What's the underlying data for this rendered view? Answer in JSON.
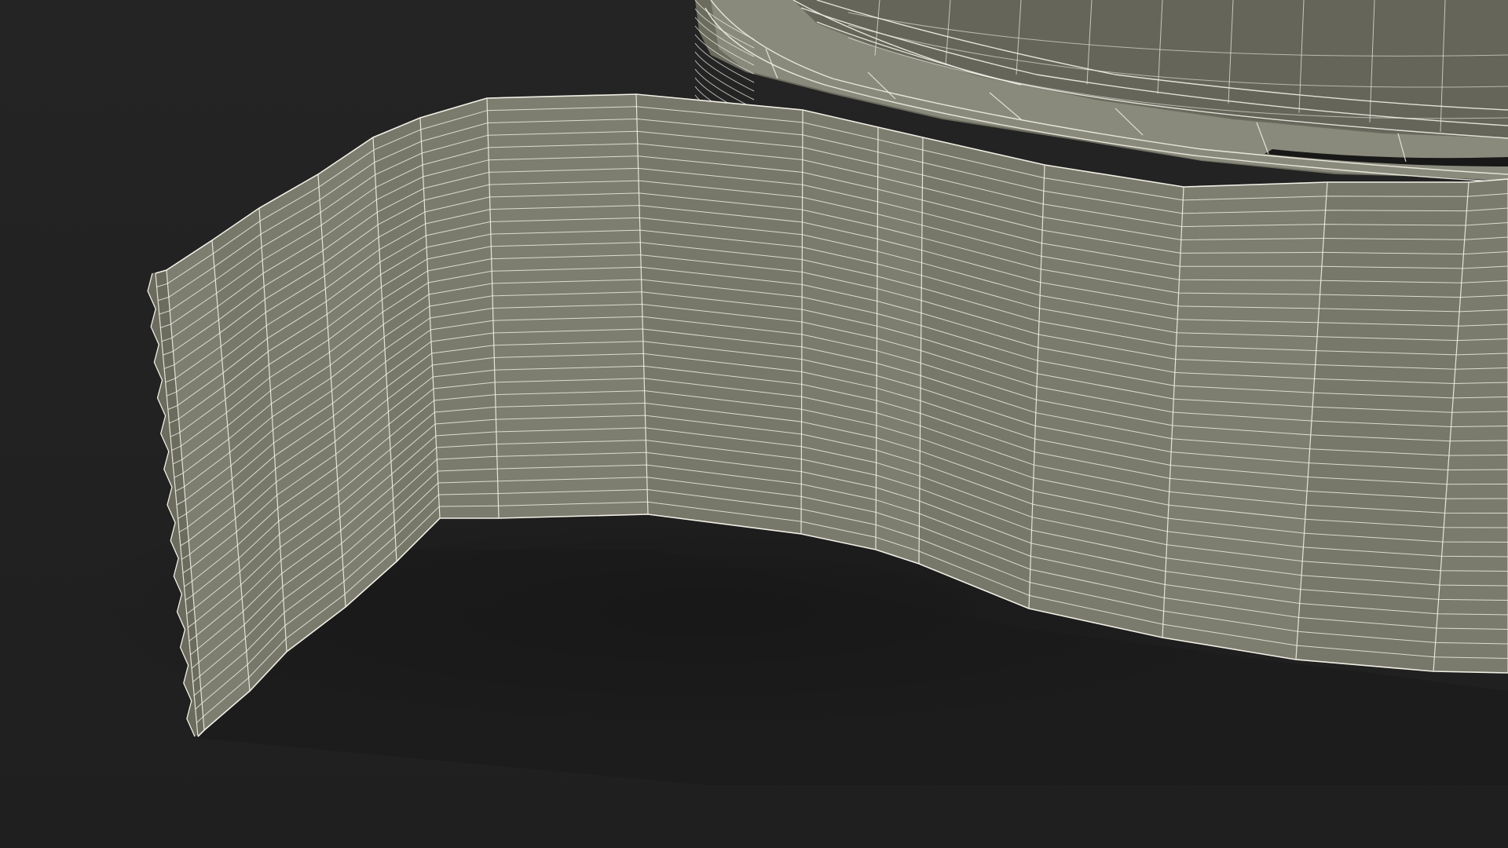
{
  "scene": {
    "subject": "wireframe-ribbon-mesh",
    "background_color": "#222222",
    "shadow_color": "#191919",
    "surface_color": "#7b7b6d",
    "surface_light_color": "#8a8a7c",
    "surface_dark_color": "#6b6b5e",
    "wire_color": "#f2f0e6"
  }
}
